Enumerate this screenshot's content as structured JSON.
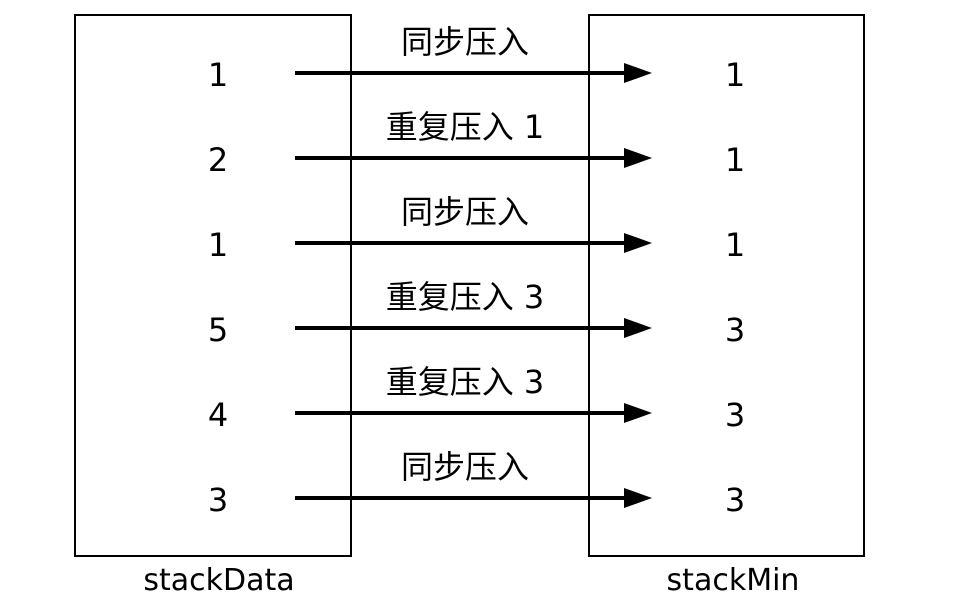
{
  "stack_data": {
    "label": "stackData",
    "values": [
      "1",
      "2",
      "1",
      "5",
      "4",
      "3"
    ]
  },
  "stack_min": {
    "label": "stackMin",
    "values": [
      "1",
      "1",
      "1",
      "3",
      "3",
      "3"
    ]
  },
  "operations": [
    "同步压入",
    "重复压入 1",
    "同步压入",
    "重复压入 3",
    "重复压入 3",
    "同步压入"
  ]
}
